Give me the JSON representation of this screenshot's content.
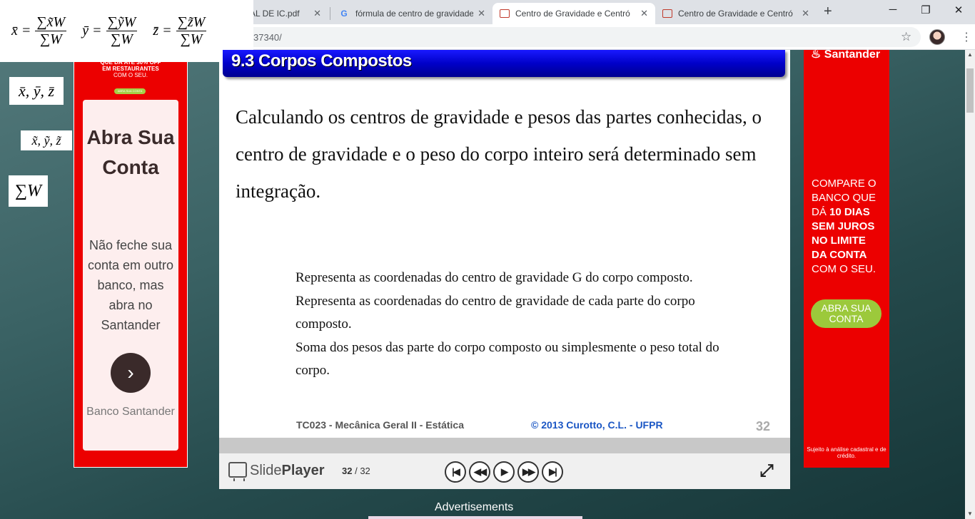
{
  "tabs": [
    {
      "title": "AL DE IC.pdf",
      "favicon": "",
      "active": false
    },
    {
      "title": "fórmula de centro de gravidade",
      "favicon": "G",
      "active": false
    },
    {
      "title": "Centro de Gravidade e Centró",
      "favicon": "slide",
      "active": true
    },
    {
      "title": "Centro de Gravidade e Centró",
      "favicon": "slide",
      "active": false
    }
  ],
  "tab_close": "✕",
  "new_tab": "+",
  "window_controls": {
    "minimize": "─",
    "restore": "❐",
    "close": "✕"
  },
  "address_bar": {
    "url": "37340/"
  },
  "formula_overlays": {
    "x_bar": "x̄ =",
    "y_bar": "ȳ =",
    "z_bar": "z̄ =",
    "x_num": "∑x̃W",
    "y_num": "∑ỹW",
    "z_num": "∑z̃W",
    "den": "∑W",
    "xyz_bar": "x̄, ȳ, z̄",
    "xyz_tilde": "x̃, ỹ, z̃",
    "sum_w": "∑W"
  },
  "left_ad": {
    "top_lines": [
      "QUE DÁ ATÉ 30% OFF",
      "EM RESTAURANTES",
      "COM O SEU."
    ],
    "mini_button": "ABRA SUA CONTA",
    "title": "Abra Sua Conta",
    "body": "Não feche sua conta em outro banco, mas abra no Santander",
    "brand": "Banco Santander"
  },
  "slide": {
    "header_title": "9.3 Corpos Compostos",
    "main_text": "Calculando os centros de gravidade e pesos das partes conhecidas, o centro de gravidade e o peso do corpo inteiro será determinado sem integração.",
    "list": [
      "Representa as coordenadas do centro de gravidade G do corpo composto.",
      "Representa as coordenadas do centro de gravidade de cada parte do corpo composto.",
      "Soma dos pesos das parte do corpo composto ou simplesmente o peso total do corpo."
    ],
    "footer_course": "TC023 - Mecânica Geral II - Estática",
    "footer_copyright": "© 2013 Curotto, C.L. - UFPR",
    "slide_number": "32"
  },
  "player": {
    "logo_slide": "Slide",
    "logo_player": "Player",
    "current": "32",
    "total": "/ 32",
    "buttons": {
      "first": "|◀",
      "prev": "◀◀",
      "play": "▶",
      "next": "▶▶",
      "last": "▶|"
    }
  },
  "right_ad": {
    "logo": "Santander",
    "line1": "COMPARE O BANCO QUE DÁ",
    "bold": "10 DIAS SEM JUROS NO LIMITE DA CONTA",
    "line2": "COM O SEU.",
    "button": "ABRA SUA CONTA",
    "footnote": "Sujeito à análise cadastral e de crédito."
  },
  "advertisements_label": "Advertisements"
}
